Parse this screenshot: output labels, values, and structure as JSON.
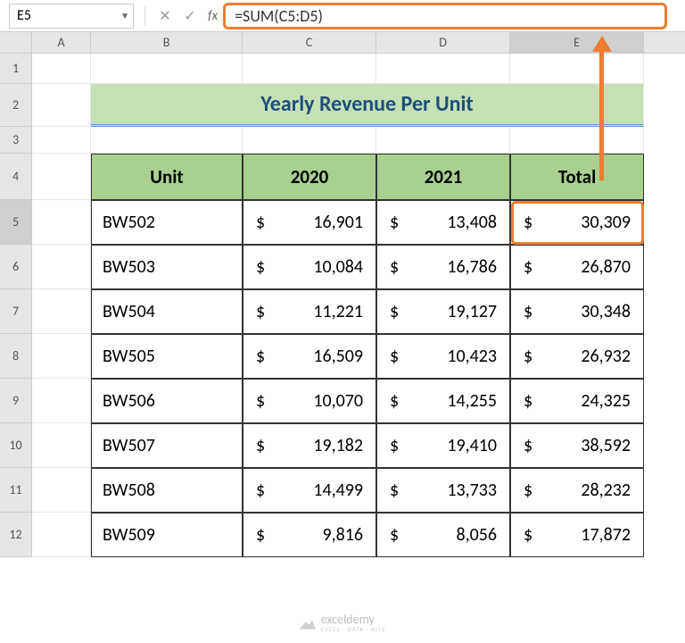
{
  "nameBox": "E5",
  "formula": "=SUM(C5:D5)",
  "columns": [
    "A",
    "B",
    "C",
    "D",
    "E"
  ],
  "selectedCol": "E",
  "selectedRow": "5",
  "title": "Yearly Revenue Per Unit",
  "headers": {
    "unit": "Unit",
    "c1": "2020",
    "c2": "2021",
    "total": "Total"
  },
  "rows": [
    {
      "unit": "BW502",
      "c1": "16,901",
      "c2": "13,408",
      "total": "30,309"
    },
    {
      "unit": "BW503",
      "c1": "10,084",
      "c2": "16,786",
      "total": "26,870"
    },
    {
      "unit": "BW504",
      "c1": "11,221",
      "c2": "19,127",
      "total": "30,348"
    },
    {
      "unit": "BW505",
      "c1": "16,509",
      "c2": "10,423",
      "total": "26,932"
    },
    {
      "unit": "BW506",
      "c1": "10,070",
      "c2": "14,255",
      "total": "24,325"
    },
    {
      "unit": "BW507",
      "c1": "19,182",
      "c2": "19,410",
      "total": "38,592"
    },
    {
      "unit": "BW508",
      "c1": "14,499",
      "c2": "13,733",
      "total": "28,232"
    },
    {
      "unit": "BW509",
      "c1": "9,816",
      "c2": "8,056",
      "total": "17,872"
    }
  ],
  "currency": "$",
  "watermark": {
    "name": "exceldemy",
    "sub": "EXCEL · DATA · BITS"
  }
}
